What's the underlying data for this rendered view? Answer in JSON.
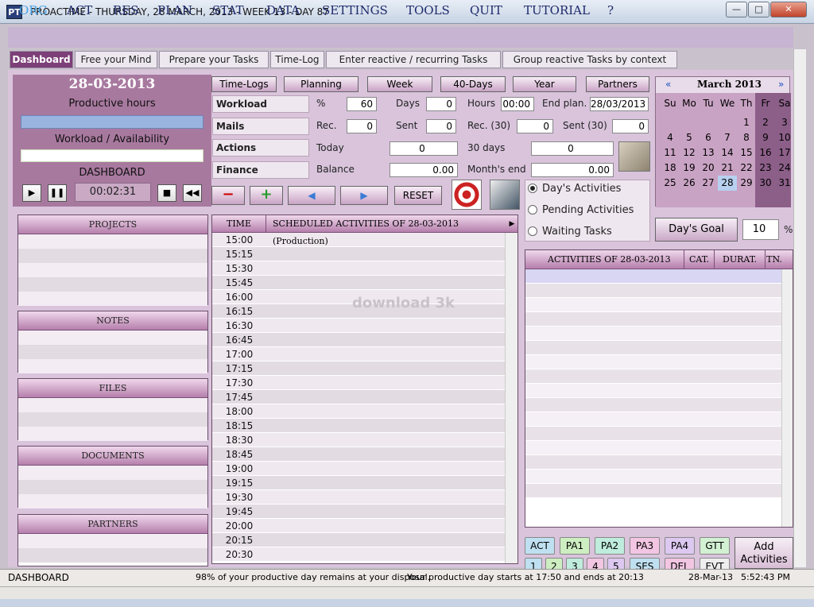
{
  "window": {
    "title": "PROACTIME - THURSDAY, 28 MARCH, 2013 - WEEK 13 - DAY 87",
    "icon_text": "PT",
    "minimize": "—",
    "maximize": "□",
    "close": "✕"
  },
  "menu": [
    "ORG",
    "ACT",
    "RES",
    "PLAN",
    "STAT",
    "DATA",
    "SETTINGS",
    "TOOLS",
    "QUIT",
    "TUTORIAL",
    "?"
  ],
  "tabs": [
    "Dashboard",
    "Free your Mind",
    "Prepare your Tasks",
    "Time-Log",
    "Enter reactive / recurring Tasks",
    "Group reactive Tasks by context"
  ],
  "dashboard": {
    "date": "28-03-2013",
    "productive_hours": "Productive hours",
    "workload": "Workload / Availability",
    "label": "DASHBOARD",
    "timer": "00:02:31"
  },
  "side_panels": [
    "PROJECTS",
    "NOTES",
    "FILES",
    "DOCUMENTS",
    "PARTNERS"
  ],
  "nav_buttons": [
    "Time-Logs",
    "Planning",
    "Week",
    "40-Days",
    "Year",
    "Partners"
  ],
  "form": {
    "workload": {
      "label": "Workload",
      "pct_label": "%",
      "pct": "60",
      "days_label": "Days",
      "days": "0",
      "hours_label": "Hours",
      "hours": "00:00",
      "endplan_label": "End plan.",
      "endplan": "28/03/2013"
    },
    "mails": {
      "label": "Mails",
      "rec_label": "Rec.",
      "rec": "0",
      "sent_label": "Sent",
      "sent": "0",
      "rec30_label": "Rec. (30)",
      "rec30": "0",
      "sent30_label": "Sent (30)",
      "sent30": "0"
    },
    "actions": {
      "label": "Actions",
      "today_label": "Today",
      "today": "0",
      "days30_label": "30 days",
      "days30": "0"
    },
    "finance": {
      "label": "Finance",
      "balance_label": "Balance",
      "balance": "0.00",
      "monthend_label": "Month's end",
      "monthend": "0.00"
    }
  },
  "reset": "RESET",
  "radio": [
    "Day's Activities",
    "Pending Activities",
    "Waiting Tasks"
  ],
  "goal": {
    "label": "Day's Goal",
    "value": "10",
    "unit": "%"
  },
  "schedule": {
    "time_header": "TIME",
    "header": "SCHEDULED ACTIVITIES OF  28-03-2013  (Production)",
    "watermark": "download 3k",
    "times": [
      "15:00",
      "15:15",
      "15:30",
      "15:45",
      "16:00",
      "16:15",
      "16:30",
      "16:45",
      "17:00",
      "17:15",
      "17:30",
      "17:45",
      "18:00",
      "18:15",
      "18:30",
      "18:45",
      "19:00",
      "19:15",
      "19:30",
      "19:45",
      "20:00",
      "20:15",
      "20:30"
    ]
  },
  "activities": {
    "header": "ACTIVITIES OF  28-03-2013",
    "cat": "CAT.",
    "durat": "DURAT.",
    "tn": "TN."
  },
  "calendar": {
    "prev": "«",
    "next": "»",
    "month": "March 2013",
    "weekdays": [
      "Su",
      "Mo",
      "Tu",
      "We",
      "Th",
      "Fr",
      "Sa"
    ],
    "weeks": [
      [
        "",
        "",
        "",
        "",
        "",
        "1",
        "2",
        "3"
      ],
      [
        "",
        "4",
        "5",
        "6",
        "7",
        "8",
        "9",
        "10"
      ],
      [
        "",
        "11",
        "12",
        "13",
        "14",
        "15",
        "16",
        "17"
      ],
      [
        "",
        "18",
        "19",
        "20",
        "21",
        "22",
        "23",
        "24"
      ],
      [
        "",
        "25",
        "26",
        "27",
        "28",
        "29",
        "30",
        "31"
      ]
    ]
  },
  "categories": [
    "ACT",
    "PA1",
    "PA2",
    "PA3",
    "PA4",
    "GTT"
  ],
  "categories2": [
    "1",
    "2",
    "3",
    "4",
    "5",
    "SES",
    "DEL",
    "EVT"
  ],
  "add_activities": "Add Activities",
  "status": {
    "left": "DASHBOARD",
    "msg1": "98% of your productive day remains at your disposal.",
    "msg2": "Your productive day starts at 17:50 and ends at 20:13",
    "date": "28-Mar-13",
    "time": "5:52:43 PM"
  },
  "colors": {
    "accent": "#7c3f78",
    "header": "#b57fac",
    "panel": "#d9c4dc"
  }
}
